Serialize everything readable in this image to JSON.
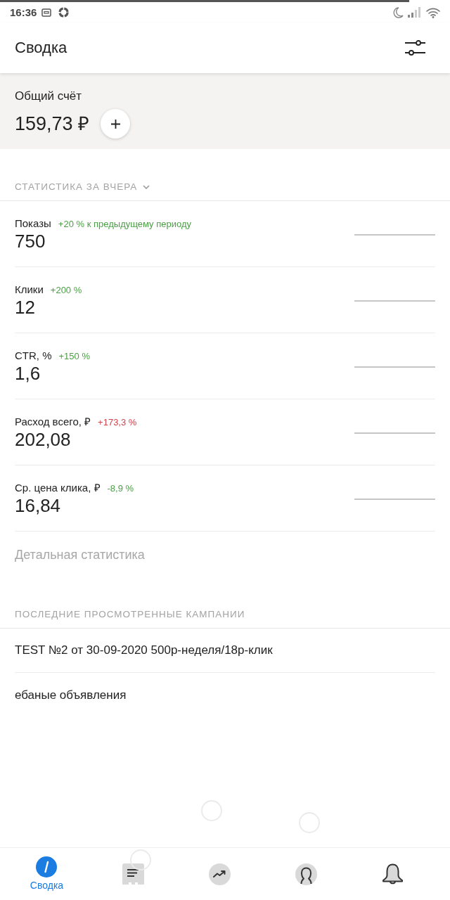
{
  "top_progress": {
    "level": 0.91
  },
  "status_bar": {
    "time": "16:36"
  },
  "header": {
    "title": "Сводка"
  },
  "account": {
    "label": "Общий счёт",
    "balance": "159,73 ₽"
  },
  "stats": {
    "title": "СТАТИСТИКА ЗА ВЧЕРА",
    "rows": [
      {
        "label": "Показы",
        "change": "+20 % к предыдущему периоду",
        "color": "#4c9d46",
        "value": "750"
      },
      {
        "label": "Клики",
        "change": "+200 %",
        "color": "#4c9d46",
        "value": "12"
      },
      {
        "label": "CTR, %",
        "change": "+150 %",
        "color": "#4c9d46",
        "value": "1,6"
      },
      {
        "label": "Расход всего, ₽",
        "change": "+173,3 %",
        "color": "#d1434a",
        "value": "202,08"
      },
      {
        "label": "Ср. цена клика, ₽",
        "change": "-8,9 %",
        "color": "#4c9d46",
        "value": "16,84"
      }
    ],
    "details_link": "Детальная статистика"
  },
  "recent_campaigns": {
    "title": "ПОСЛЕДНИЕ ПРОСМОТРЕННЫЕ КАМПАНИИ",
    "items": [
      "TEST №2 от 30-09-2020 500р-неделя/18р-клик",
      "ебаные объявления"
    ]
  },
  "bottom_nav": [
    {
      "kind": "summary",
      "label": "Сводка",
      "selected": true
    },
    {
      "kind": "campaigns",
      "selected": false
    },
    {
      "kind": "statistics",
      "selected": false
    },
    {
      "kind": "profile",
      "selected": false
    },
    {
      "kind": "notifications",
      "selected": false
    }
  ]
}
